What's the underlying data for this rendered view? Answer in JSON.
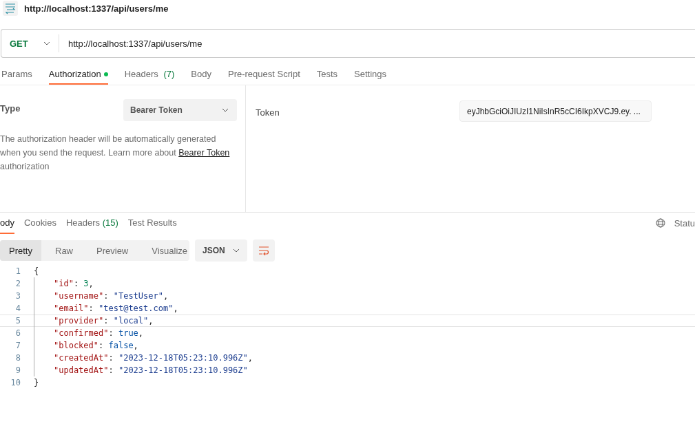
{
  "request": {
    "title": "http://localhost:1337/api/users/me",
    "method": "GET",
    "url": "http://localhost:1337/api/users/me"
  },
  "request_tabs": [
    {
      "label": "Params",
      "selected": false
    },
    {
      "label": "Authorization",
      "selected": true,
      "dot": true
    },
    {
      "label": "Headers",
      "count": "(7)",
      "selected": false
    },
    {
      "label": "Body",
      "selected": false
    },
    {
      "label": "Pre-request Script",
      "selected": false
    },
    {
      "label": "Tests",
      "selected": false
    },
    {
      "label": "Settings",
      "selected": false
    }
  ],
  "auth": {
    "type_label": "Type",
    "type_value": "Bearer Token",
    "description": "The authorization header will be automatically generated when you send the request. Learn more about ",
    "link": "Bearer Token",
    "description_end": "authorization",
    "token_label": "Token",
    "token_value": "eyJhbGciOiJIUzI1NiIsInR5cCI6IkpXVCJ9.ey. ..."
  },
  "response_tabs": [
    {
      "label": "ody",
      "selected": true
    },
    {
      "label": "Cookies",
      "selected": false
    },
    {
      "label": "Headers",
      "count": "(15)",
      "selected": false
    },
    {
      "label": "Test Results",
      "selected": false
    }
  ],
  "status": "Statu",
  "view_modes": [
    {
      "label": "Pretty",
      "selected": true
    },
    {
      "label": "Raw",
      "selected": false
    },
    {
      "label": "Preview",
      "selected": false
    },
    {
      "label": "Visualize",
      "selected": false
    }
  ],
  "format": "JSON",
  "code_lines": [
    {
      "number": "1",
      "active": false,
      "tokens": [
        {
          "kind": "punct",
          "text": "{"
        }
      ]
    },
    {
      "number": "2",
      "active": false,
      "tokens": [
        {
          "kind": "key",
          "text": "\"id\""
        },
        {
          "kind": "punct",
          "text": ": "
        },
        {
          "kind": "number",
          "text": "3"
        },
        {
          "kind": "punct",
          "text": ","
        }
      ]
    },
    {
      "number": "3",
      "active": false,
      "tokens": [
        {
          "kind": "key",
          "text": "\"username\""
        },
        {
          "kind": "punct",
          "text": ": "
        },
        {
          "kind": "string",
          "text": "\"TestUser\""
        },
        {
          "kind": "punct",
          "text": ","
        }
      ]
    },
    {
      "number": "4",
      "active": false,
      "tokens": [
        {
          "kind": "key",
          "text": "\"email\""
        },
        {
          "kind": "punct",
          "text": ": "
        },
        {
          "kind": "string",
          "text": "\"test@test.com\""
        },
        {
          "kind": "punct",
          "text": ","
        }
      ]
    },
    {
      "number": "5",
      "active": true,
      "tokens": [
        {
          "kind": "key",
          "text": "\"provider\""
        },
        {
          "kind": "punct",
          "text": ": "
        },
        {
          "kind": "string",
          "text": "\"local\""
        },
        {
          "kind": "punct",
          "text": ","
        }
      ]
    },
    {
      "number": "6",
      "active": false,
      "tokens": [
        {
          "kind": "key",
          "text": "\"confirmed\""
        },
        {
          "kind": "punct",
          "text": ": "
        },
        {
          "kind": "boolean",
          "text": "true"
        },
        {
          "kind": "punct",
          "text": ","
        }
      ]
    },
    {
      "number": "7",
      "active": false,
      "tokens": [
        {
          "kind": "key",
          "text": "\"blocked\""
        },
        {
          "kind": "punct",
          "text": ": "
        },
        {
          "kind": "boolean",
          "text": "false"
        },
        {
          "kind": "punct",
          "text": ","
        }
      ]
    },
    {
      "number": "8",
      "active": false,
      "tokens": [
        {
          "kind": "key",
          "text": "\"createdAt\""
        },
        {
          "kind": "punct",
          "text": ": "
        },
        {
          "kind": "string",
          "text": "\"2023-12-18T05:23:10.996Z\""
        },
        {
          "kind": "punct",
          "text": ","
        }
      ]
    },
    {
      "number": "9",
      "active": false,
      "tokens": [
        {
          "kind": "key",
          "text": "\"updatedAt\""
        },
        {
          "kind": "punct",
          "text": ": "
        },
        {
          "kind": "string",
          "text": "\"2023-12-18T05:23:10.996Z\""
        }
      ]
    },
    {
      "number": "10",
      "active": false,
      "tokens": [
        {
          "kind": "punct",
          "text": "}"
        }
      ]
    }
  ]
}
